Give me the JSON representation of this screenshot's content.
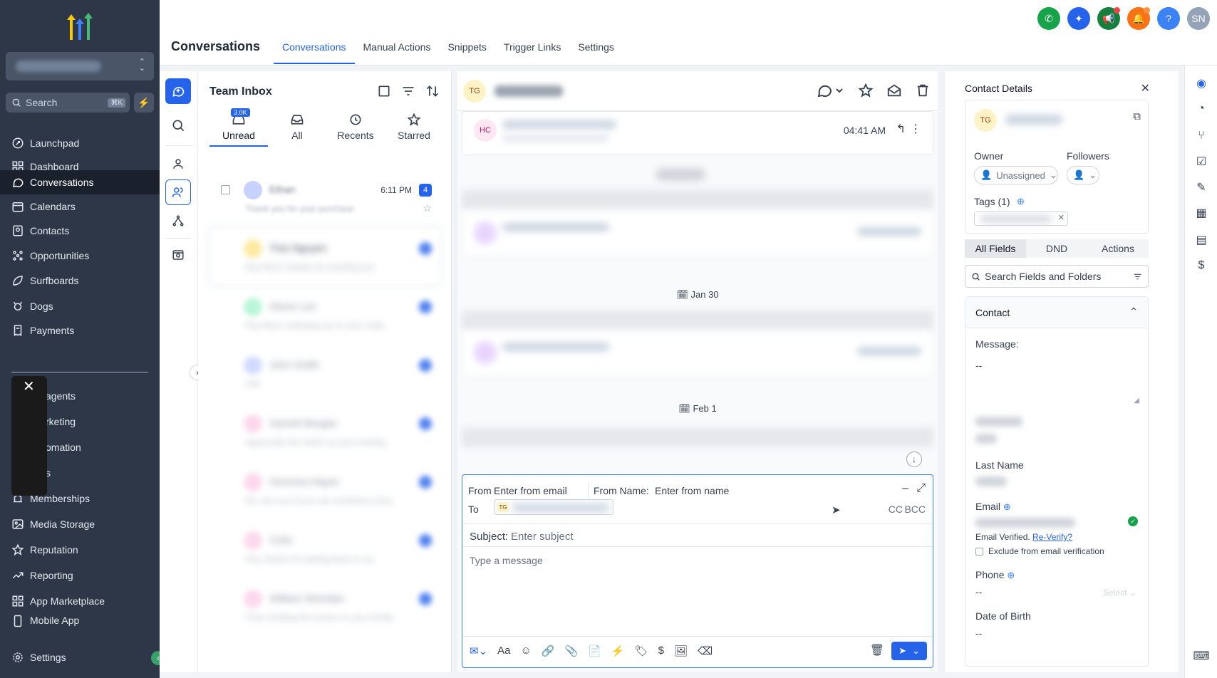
{
  "sidebar": {
    "search_placeholder": "Search",
    "search_shortcut": "⌘K",
    "items": [
      {
        "label": "Launchpad"
      },
      {
        "label": "Dashboard"
      },
      {
        "label": "Conversations"
      },
      {
        "label": "Calendars"
      },
      {
        "label": "Contacts"
      },
      {
        "label": "Opportunities"
      },
      {
        "label": "Surfboards"
      },
      {
        "label": "Dogs"
      },
      {
        "label": "Payments"
      }
    ],
    "items2": [
      {
        "label": "agents"
      },
      {
        "label": "rketing"
      },
      {
        "label": "omation"
      },
      {
        "label": "s"
      },
      {
        "label": "Memberships"
      },
      {
        "label": "Media Storage"
      },
      {
        "label": "Reputation"
      },
      {
        "label": "Reporting"
      },
      {
        "label": "App Marketplace"
      },
      {
        "label": "Mobile App"
      }
    ],
    "settings_label": "Settings"
  },
  "header": {
    "title": "Conversations",
    "tabs": [
      {
        "label": "Conversations"
      },
      {
        "label": "Manual Actions"
      },
      {
        "label": "Snippets"
      },
      {
        "label": "Trigger Links"
      },
      {
        "label": "Settings"
      }
    ],
    "avatar_initials": "SN",
    "help": "?",
    "colors": {
      "phone": "#16a34a",
      "ai": "#2563eb",
      "megaphone": "#15803d",
      "bell": "#f97316",
      "help": "#3b82f6",
      "avatar": "#94a3b8"
    }
  },
  "inbox": {
    "title": "Team Inbox",
    "tabs": [
      {
        "label": "Unread",
        "count": "3.0K"
      },
      {
        "label": "All"
      },
      {
        "label": "Recents"
      },
      {
        "label": "Starred"
      }
    ],
    "first": {
      "time": "6:11 PM",
      "unread": "4"
    }
  },
  "conversation": {
    "contact_initials": "TG",
    "message_initials": "HC",
    "message_time": "04:41 AM",
    "dates": [
      "Jan 30",
      "Feb 1"
    ],
    "composer": {
      "from_label": "From",
      "from_placeholder": "Enter from email",
      "from_name_label": "From Name:",
      "from_name_placeholder": "Enter from name",
      "to_label": "To",
      "to_initials": "TG",
      "cc": "CC",
      "bcc": "BCC",
      "subject_label": "Subject:",
      "subject_placeholder": "Enter subject",
      "message_placeholder": "Type a message"
    }
  },
  "contact": {
    "title": "Contact Details",
    "initials": "TG",
    "owner_label": "Owner",
    "owner_value": "Unassigned",
    "followers_label": "Followers",
    "tags_label": "Tags (1)",
    "tabs": [
      {
        "label": "All Fields"
      },
      {
        "label": "DND"
      },
      {
        "label": "Actions"
      }
    ],
    "search_placeholder": "Search Fields and Folders",
    "section": "Contact",
    "message_label": "Message:",
    "message_value": "--",
    "last_name_label": "Last Name",
    "email_label": "Email",
    "email_verified": "Email Verified.",
    "reverify": "Re-Verify?",
    "exclude_label": "Exclude from email verification",
    "phone_label": "Phone",
    "phone_value": "--",
    "phone_select": "Select",
    "dob_label": "Date of Birth",
    "dob_value": "--"
  }
}
